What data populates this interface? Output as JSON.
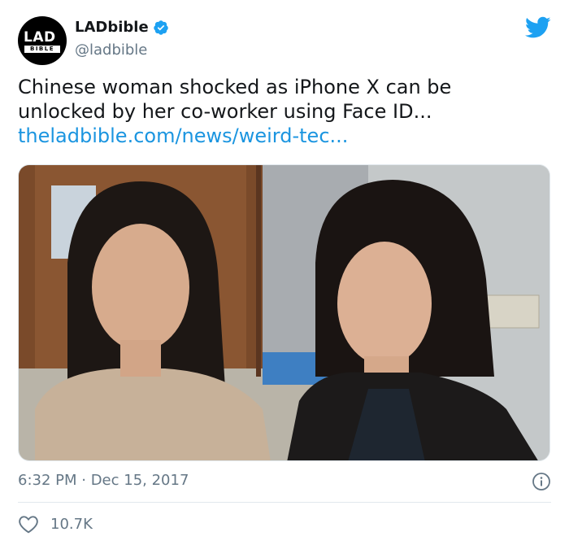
{
  "account": {
    "display_name": "LADbible",
    "handle": "@ladbible",
    "avatar_logo_top": "LAD",
    "avatar_logo_bottom": "BIBLE",
    "verified": true
  },
  "tweet": {
    "text_lines": [
      "Chinese woman shocked as iPhone X can be",
      "unlocked by her co-worker using Face ID..."
    ],
    "link": "theladbible.com/news/weird-tec..."
  },
  "meta": {
    "timestamp": "6:32 PM · Dec 15, 2017",
    "like_count": "10.7K"
  },
  "icons": {
    "brand": "twitter-bird-icon",
    "verified": "verified-badge-icon",
    "info": "info-icon",
    "like": "heart-icon"
  },
  "colors": {
    "twitter_blue": "#1da1f2",
    "link_blue": "#1b95e0",
    "muted_text": "#657786",
    "primary_text": "#14171a"
  }
}
